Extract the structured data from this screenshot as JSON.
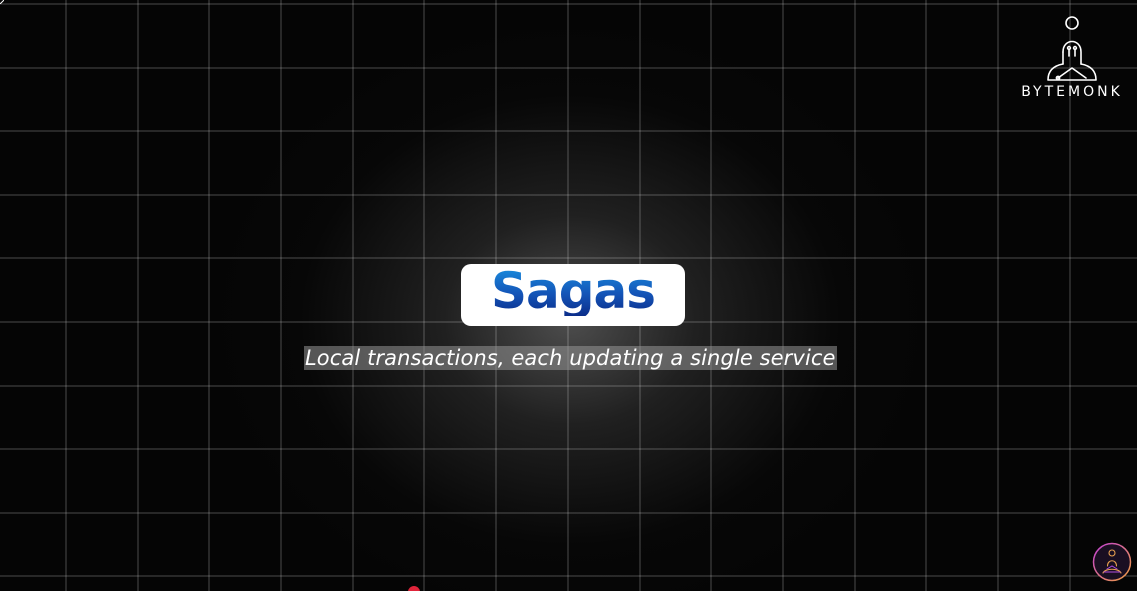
{
  "slide": {
    "title": "Sagas",
    "subtitle": "Local transactions, each updating a single service"
  },
  "brand": {
    "name": "BYTEMONK",
    "logo_icon": "monk-meditating-icon",
    "avatar_icon": "monk-avatar-icon"
  },
  "colors": {
    "background": "#050505",
    "grid": "rgba(255,255,255,0.28)",
    "title_gradient_top": "#1a8fdf",
    "title_gradient_bottom": "#0b2d8a",
    "card": "#ffffff",
    "cursor": "#e0243a"
  }
}
